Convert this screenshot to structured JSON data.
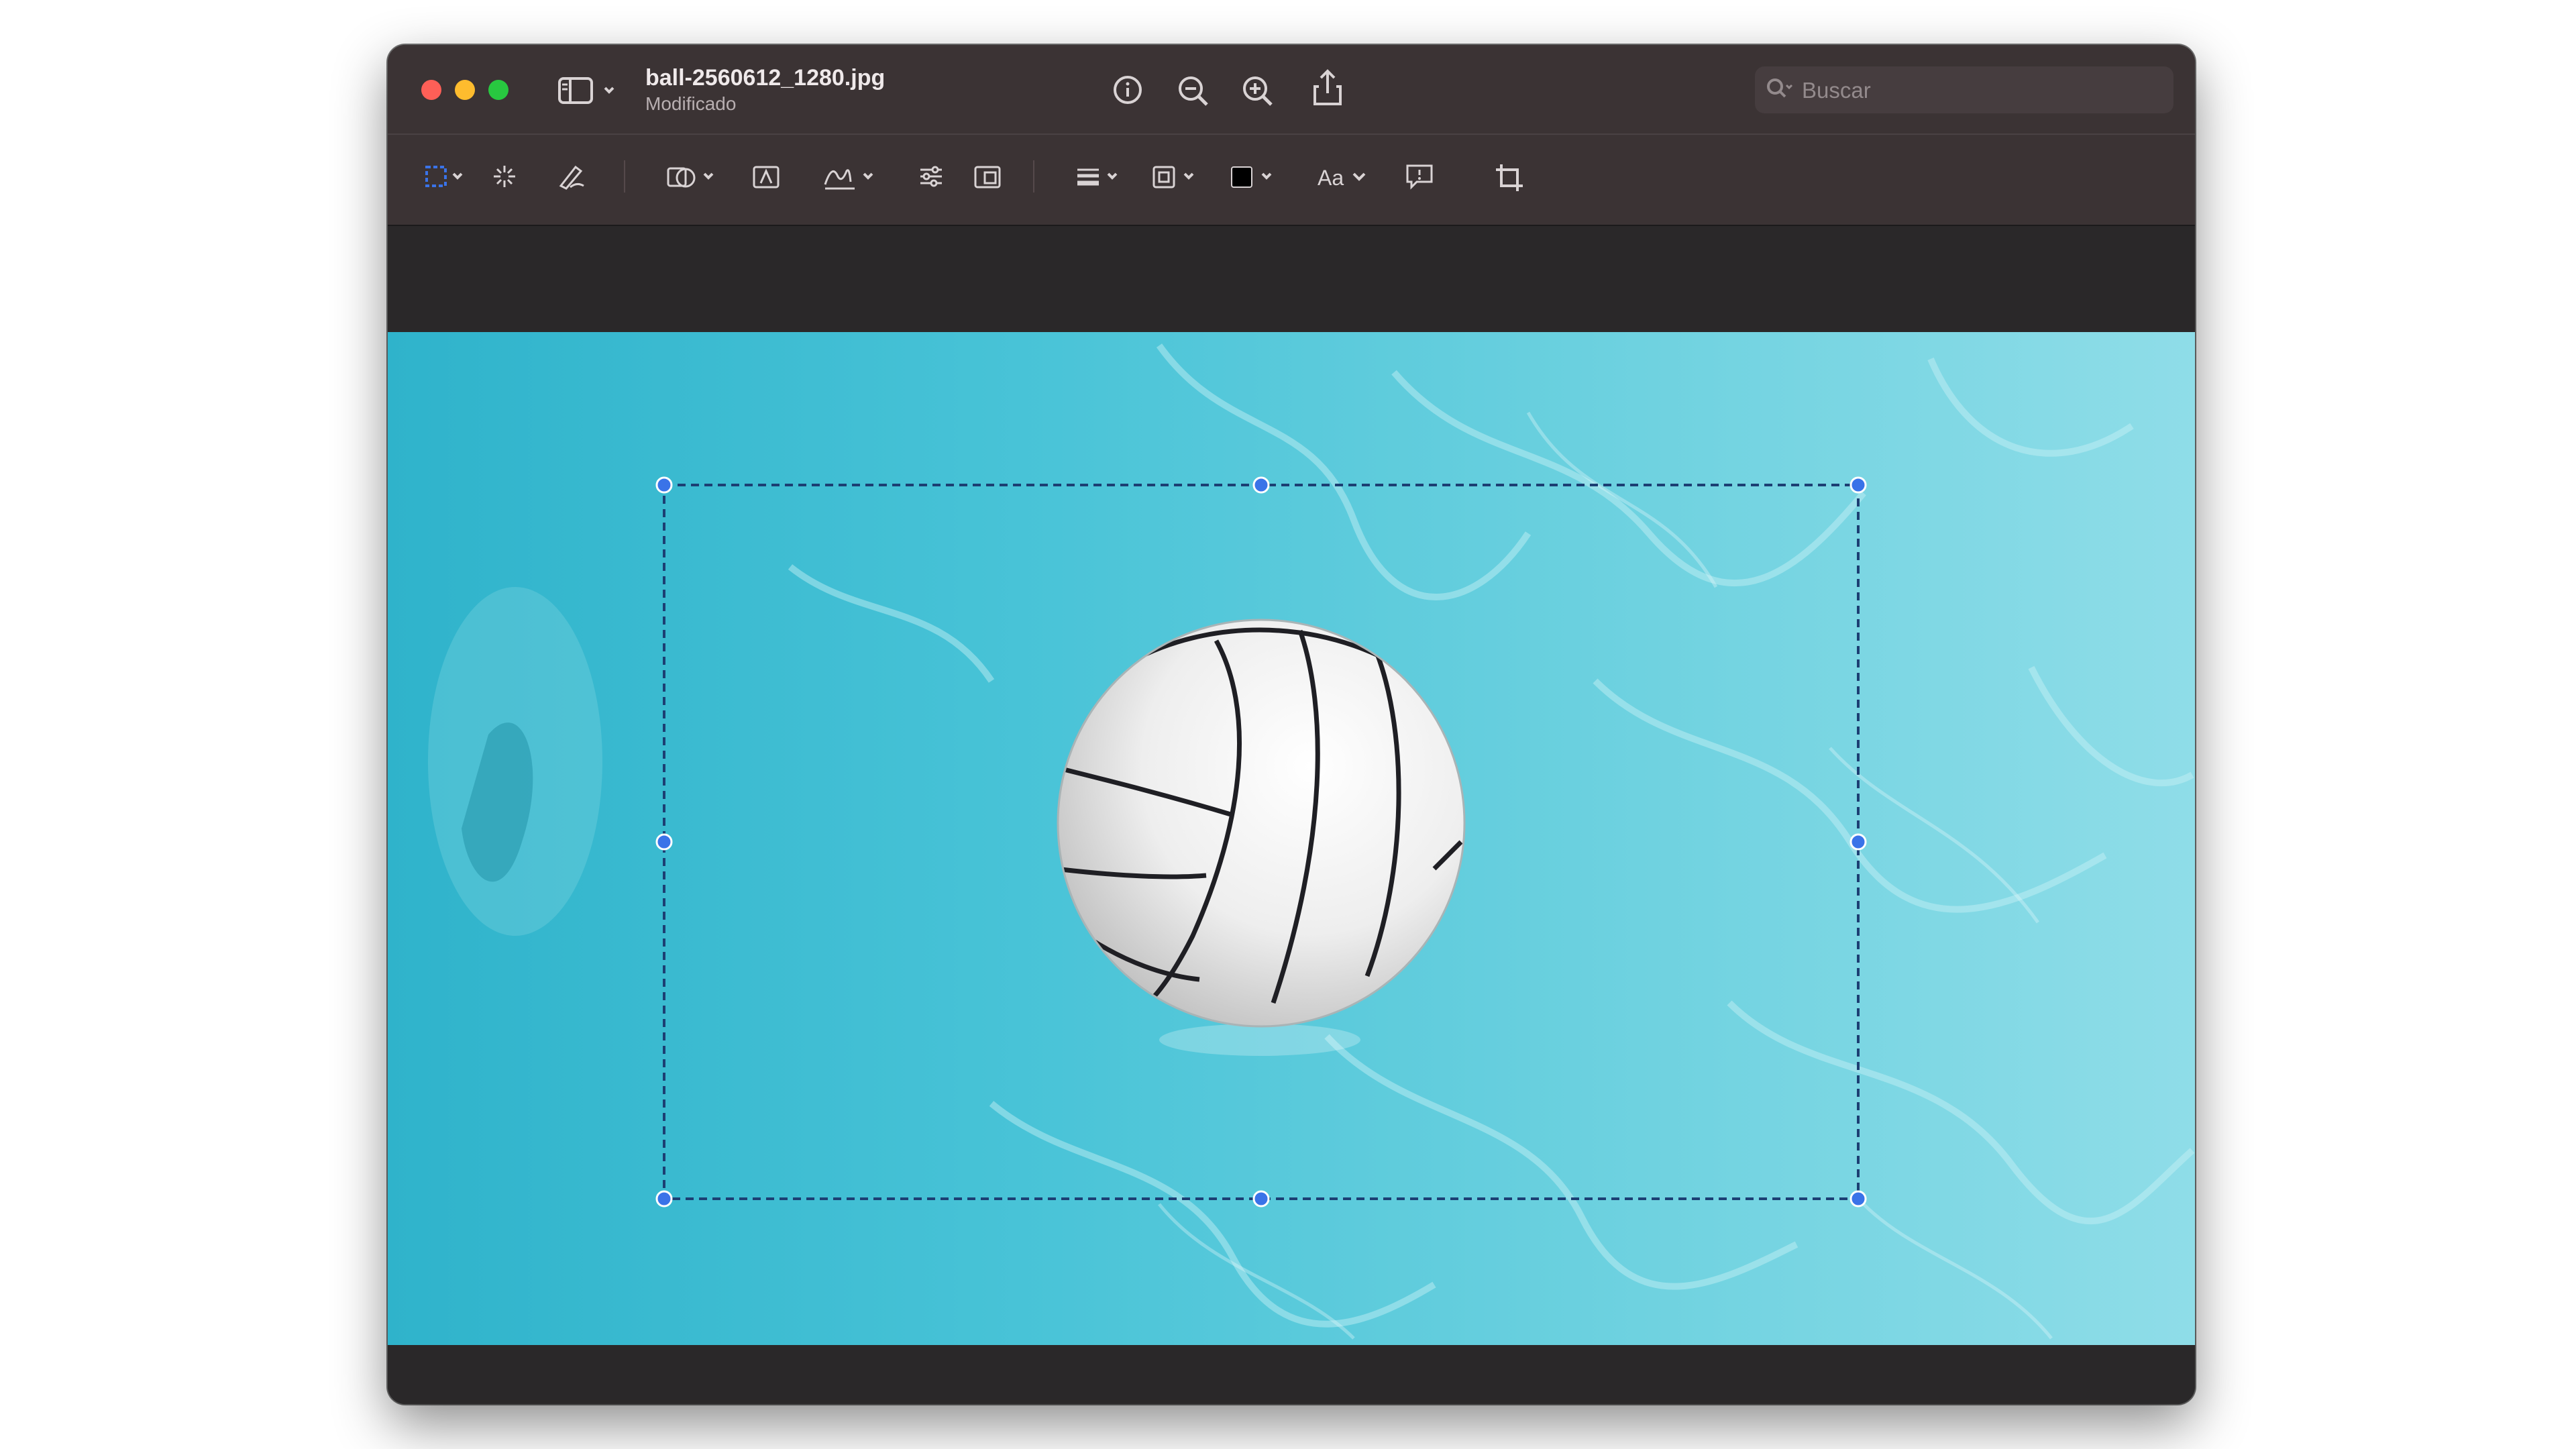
{
  "window": {
    "filename": "ball-2560612_1280.jpg",
    "status": "Modificado"
  },
  "search": {
    "placeholder": "Buscar"
  },
  "toolbar": {
    "font_label": "Aa"
  },
  "icons": {
    "sidebar": "sidebar-icon",
    "info": "info-icon",
    "zoom_out": "zoom-out-icon",
    "zoom_in": "zoom-in-icon",
    "share": "share-icon",
    "highlight": "highlight-pen-icon",
    "rotate": "rotate-icon",
    "markup": "markup-icon",
    "form": "form-fill-icon",
    "rect_select": "rectangular-selection-icon",
    "instant_alpha": "instant-alpha-icon",
    "sketch": "sketch-icon",
    "shapes": "shapes-icon",
    "text": "text-box-icon",
    "sign": "signature-icon",
    "adjust": "adjust-color-icon",
    "size": "adjust-size-icon",
    "shape_style": "shape-style-icon",
    "border_color": "border-color-icon",
    "fill_color": "fill-color-icon",
    "note": "note-icon",
    "crop": "crop-icon"
  },
  "colors": {
    "accent": "#3a73e8",
    "pool": "#47c3d6",
    "fill_swatch": "#000000"
  }
}
